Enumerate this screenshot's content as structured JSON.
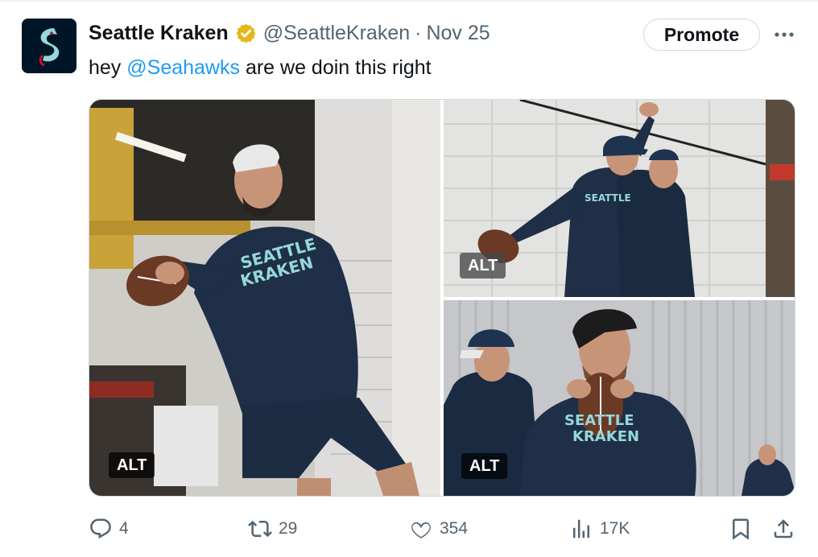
{
  "tweet": {
    "author_name": "Seattle Kraken",
    "handle": "@SeattleKraken",
    "separator": "·",
    "date": "Nov 25",
    "text_before": "hey ",
    "mention": "@Seahawks",
    "text_after": " are we doin this right"
  },
  "header": {
    "promote_label": "Promote",
    "avatar_icon": "kraken-logo-icon",
    "verified_icon": "verified-gold-badge-icon",
    "more_icon": "more-horizontal-icon"
  },
  "media": {
    "photos": [
      {
        "alt_badge": "ALT"
      },
      {
        "alt_badge": "ALT"
      },
      {
        "alt_badge": "ALT"
      }
    ]
  },
  "actions": {
    "replies": "4",
    "reposts": "29",
    "likes": "354",
    "views": "17K",
    "icons": [
      "reply-icon",
      "repost-icon",
      "like-icon",
      "views-icon",
      "bookmark-icon",
      "share-icon"
    ]
  },
  "colors": {
    "text": "#0f1419",
    "muted": "#536471",
    "link": "#1d9bf0",
    "border": "#cfd9de",
    "kraken_navy": "#001628",
    "kraken_teal": "#96d8d8",
    "verified_gold": "#e2b719"
  }
}
